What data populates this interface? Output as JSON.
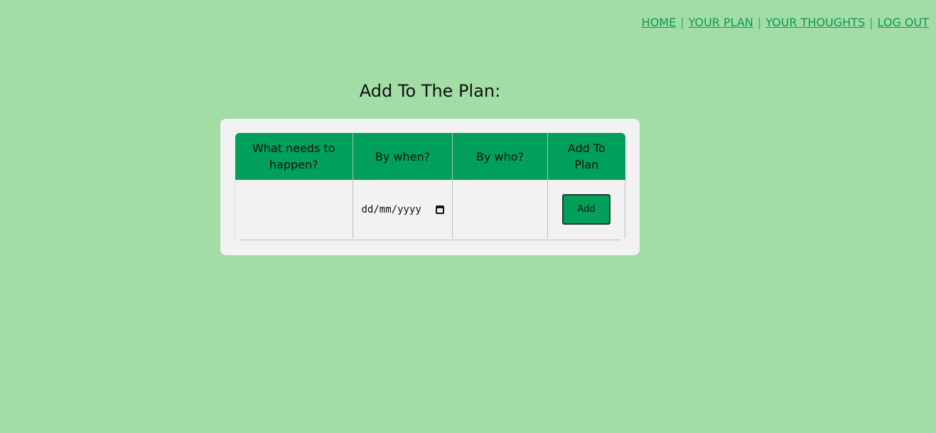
{
  "nav": {
    "home": "HOME",
    "your_plan": "YOUR PLAN",
    "your_thoughts": "YOUR THOUGHTS",
    "log_out": "LOG OUT",
    "separator": "|"
  },
  "page": {
    "title": "Add To The Plan:"
  },
  "table": {
    "headers": [
      "What needs to happen?",
      "By when?",
      "By who?",
      "Add To Plan"
    ],
    "date_placeholder": "dd/mm/yyyy",
    "add_button_label": "Add"
  },
  "colors": {
    "background": "#a2dda6",
    "header": "#00a05a",
    "card": "#f2f2f2",
    "link": "#0a9a54"
  }
}
